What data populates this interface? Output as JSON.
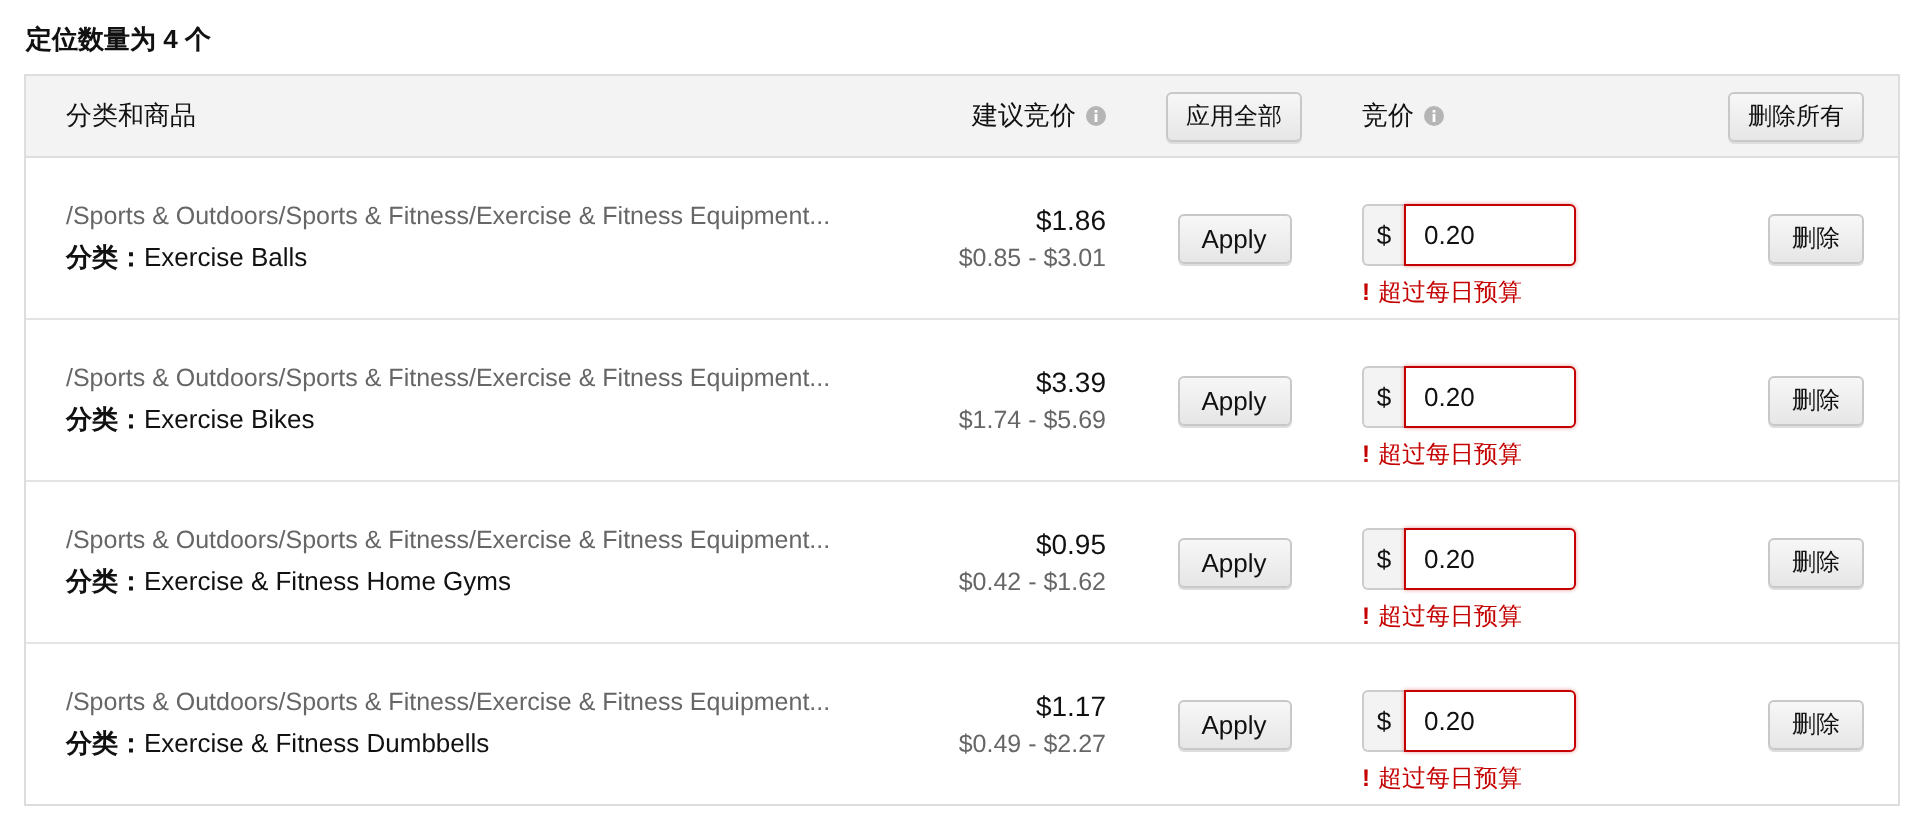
{
  "title": "定位数量为 4 个",
  "header": {
    "category": "分类和商品",
    "suggested_bid": "建议竞价",
    "apply_all": "应用全部",
    "bid": "竞价",
    "delete_all": "删除所有"
  },
  "rows": [
    {
      "path": "/Sports & Outdoors/Sports & Fitness/Exercise & Fitness Equipment...",
      "category": "**分类：**Exercise Balls",
      "price": "$1.86",
      "range": "$0.85 - $3.01",
      "apply": "Apply",
      "currency": "$",
      "bid": "0.20",
      "invalid": true,
      "error_mark": "!",
      "error": "超过每日预算",
      "delete": "删除"
    },
    {
      "path": "/Sports & Outdoors/Sports & Fitness/Exercise & Fitness Equipment...",
      "category": "**分类：**Exercise Bikes",
      "price": "$3.39",
      "range": "$1.74 - $5.69",
      "apply": "Apply",
      "currency": "$",
      "bid": "0.20",
      "invalid": true,
      "error_mark": "!",
      "error": "超过每日预算",
      "delete": "删除"
    },
    {
      "path": "/Sports & Outdoors/Sports & Fitness/Exercise & Fitness Equipment...",
      "category": "**分类：**Exercise & Fitness Home Gyms",
      "price": "$0.95",
      "range": "$0.42 - $1.62",
      "apply": "Apply",
      "currency": "$",
      "bid": "0.20",
      "invalid": true,
      "error_mark": "!",
      "error": "超过每日预算",
      "delete": "删除"
    },
    {
      "path": "/Sports & Outdoors/Sports & Fitness/Exercise & Fitness Equipment...",
      "category": "**分类：**Exercise & Fitness Dumbbells",
      "price": "$1.17",
      "range": "$0.49 - $2.27",
      "apply": "Apply",
      "currency": "$",
      "bid": "0.20",
      "invalid": true,
      "error_mark": "!",
      "error": "超过每日预算",
      "delete": "删除"
    }
  ]
}
